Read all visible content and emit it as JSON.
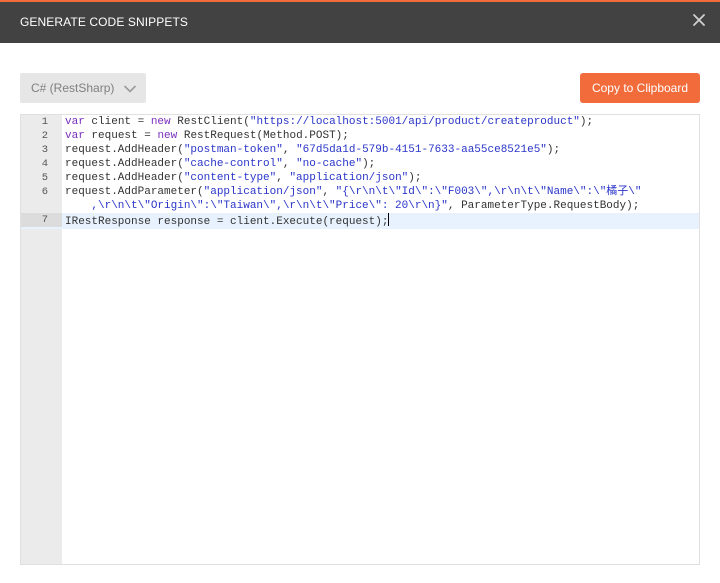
{
  "dialog": {
    "title": "GENERATE CODE SNIPPETS",
    "close_icon": "close-icon"
  },
  "toolbar": {
    "language_selected": "C# (RestSharp)",
    "copy_label": "Copy to Clipboard"
  },
  "colors": {
    "titlebar": "#424242",
    "accent": "#f26b3a",
    "keyword": "#7b2fbe",
    "string": "#2a35c8"
  },
  "editor": {
    "line_numbers": [
      "1",
      "2",
      "3",
      "4",
      "5",
      "6",
      "7"
    ],
    "active_line": "7",
    "tokens": {
      "l1_var": "var",
      "l1_a": " client = ",
      "l1_new": "new",
      "l1_b": " RestClient(",
      "l1_url": "\"https://localhost:5001/api/product/createproduct\"",
      "l1_c": ");",
      "l2_var": "var",
      "l2_a": " request = ",
      "l2_new": "new",
      "l2_b": " RestRequest(Method.POST);",
      "l3_a": "request.AddHeader(",
      "l3_s1": "\"postman-token\"",
      "l3_b": ", ",
      "l3_s2": "\"67d5da1d-579b-4151-7633-aa55ce8521e5\"",
      "l3_c": ");",
      "l4_a": "request.AddHeader(",
      "l4_s1": "\"cache-control\"",
      "l4_b": ", ",
      "l4_s2": "\"no-cache\"",
      "l4_c": ");",
      "l5_a": "request.AddHeader(",
      "l5_s1": "\"content-type\"",
      "l5_b": ", ",
      "l5_s2": "\"application/json\"",
      "l5_c": ");",
      "l6_a": "request.AddParameter(",
      "l6_s1": "\"application/json\"",
      "l6_b": ", ",
      "l6_s2": "\"{\\r\\n\\t\\\"Id\\\":\\\"F003\\\",\\r\\n\\t\\\"Name\\\":\\\"橘子\\\"",
      "l6w_s2": "    ,\\r\\n\\t\\\"Origin\\\":\\\"Taiwan\\\",\\r\\n\\t\\\"Price\\\": 20\\r\\n}\"",
      "l6w_c": ", ParameterType.RequestBody);",
      "l7_a": "IRestResponse response = client.Execute(request);"
    }
  }
}
